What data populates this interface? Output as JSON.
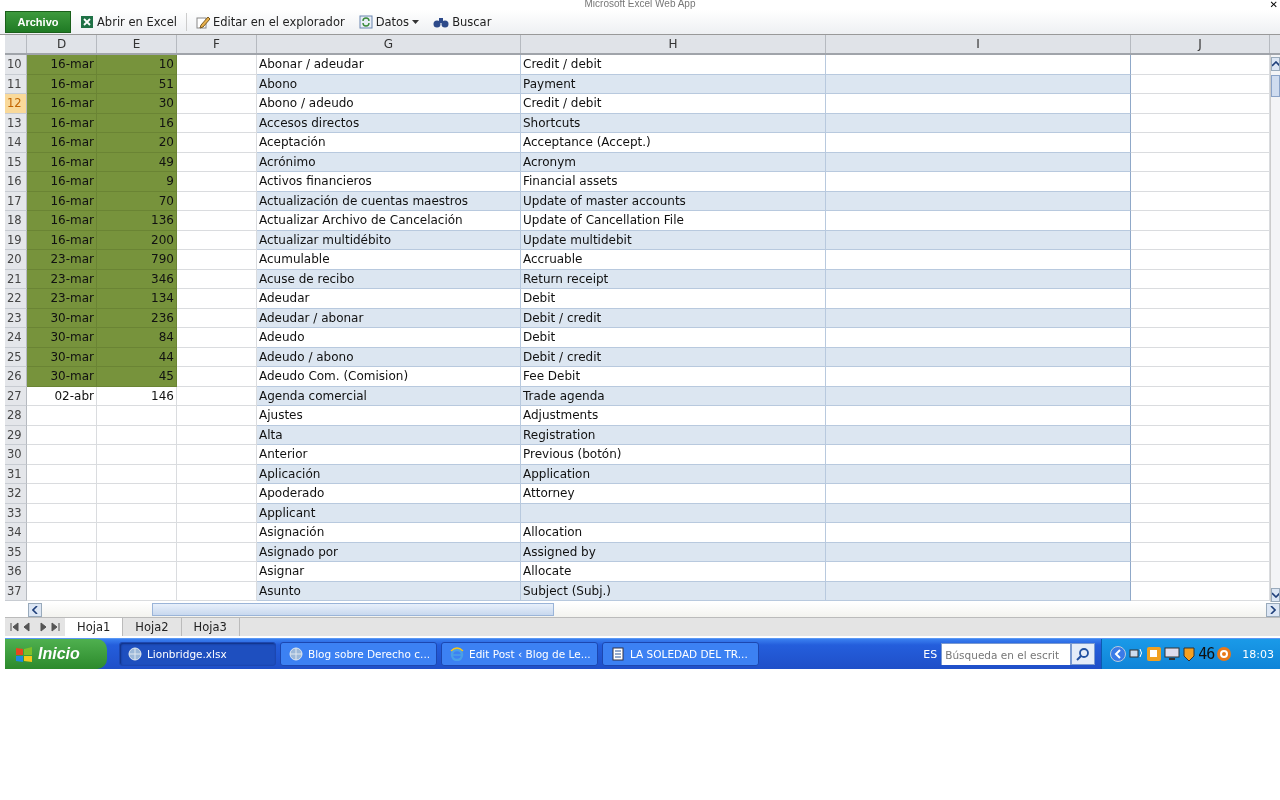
{
  "window": {
    "title": "Microsoft Excel Web App",
    "close": "✕"
  },
  "toolbar": {
    "file_tab": "Archivo",
    "buttons": [
      {
        "label": "Abrir en Excel",
        "kind": "excel"
      },
      {
        "label": "Editar en el explorador",
        "kind": "edit"
      },
      {
        "label": "Datos",
        "kind": "data"
      },
      {
        "label": "Buscar",
        "kind": "find"
      }
    ]
  },
  "columns": [
    "D",
    "E",
    "F",
    "G",
    "H",
    "I",
    "J"
  ],
  "rows": [
    {
      "n": "10",
      "date": "16-mar",
      "value": "10",
      "es": "Abonar / adeudar",
      "en": "Credit / debit",
      "filled": true,
      "selected": false
    },
    {
      "n": "11",
      "date": "16-mar",
      "value": "51",
      "es": "Abono",
      "en": "Payment",
      "filled": true,
      "selected": false
    },
    {
      "n": "12",
      "date": "16-mar",
      "value": "30",
      "es": "Abono / adeudo",
      "en": "Credit / debit",
      "filled": true,
      "selected": true
    },
    {
      "n": "13",
      "date": "16-mar",
      "value": "16",
      "es": "Accesos directos",
      "en": "Shortcuts",
      "filled": true,
      "selected": false
    },
    {
      "n": "14",
      "date": "16-mar",
      "value": "20",
      "es": "Aceptación",
      "en": "Acceptance (Accept.)",
      "filled": true,
      "selected": false
    },
    {
      "n": "15",
      "date": "16-mar",
      "value": "49",
      "es": "Acrónimo",
      "en": "Acronym",
      "filled": true,
      "selected": false
    },
    {
      "n": "16",
      "date": "16-mar",
      "value": "9",
      "es": "Activos financieros",
      "en": "Financial assets",
      "filled": true,
      "selected": false
    },
    {
      "n": "17",
      "date": "16-mar",
      "value": "70",
      "es": "Actualización de cuentas maestros",
      "en": "Update of master accounts",
      "filled": true,
      "selected": false
    },
    {
      "n": "18",
      "date": "16-mar",
      "value": "136",
      "es": "Actualizar Archivo de Cancelación",
      "en": "Update of Cancellation File",
      "filled": true,
      "selected": false
    },
    {
      "n": "19",
      "date": "16-mar",
      "value": "200",
      "es": "Actualizar multidébito",
      "en": "Update multidebit",
      "filled": true,
      "selected": false
    },
    {
      "n": "20",
      "date": "23-mar",
      "value": "790",
      "es": "Acumulable",
      "en": "Accruable",
      "filled": true,
      "selected": false
    },
    {
      "n": "21",
      "date": "23-mar",
      "value": "346",
      "es": "Acuse de recibo",
      "en": "Return receipt",
      "filled": true,
      "selected": false
    },
    {
      "n": "22",
      "date": "23-mar",
      "value": "134",
      "es": "Adeudar",
      "en": "Debit",
      "filled": true,
      "selected": false
    },
    {
      "n": "23",
      "date": "30-mar",
      "value": "236",
      "es": "Adeudar / abonar",
      "en": "Debit / credit",
      "filled": true,
      "selected": false
    },
    {
      "n": "24",
      "date": "30-mar",
      "value": "84",
      "es": "Adeudo",
      "en": "Debit",
      "filled": true,
      "selected": false
    },
    {
      "n": "25",
      "date": "30-mar",
      "value": "44",
      "es": "Adeudo / abono",
      "en": "Debit / credit",
      "filled": true,
      "selected": false
    },
    {
      "n": "26",
      "date": "30-mar",
      "value": "45",
      "es": "Adeudo Com. (Comision)",
      "en": "Fee Debit",
      "filled": true,
      "selected": false
    },
    {
      "n": "27",
      "date": "02-abr",
      "value": "146",
      "es": "Agenda comercial",
      "en": "Trade agenda",
      "filled": false,
      "selected": false
    },
    {
      "n": "28",
      "es": "Ajustes",
      "en": "Adjustments",
      "filled": false,
      "selected": false
    },
    {
      "n": "29",
      "es": "Alta",
      "en": "Registration",
      "filled": false,
      "selected": false
    },
    {
      "n": "30",
      "es": "Anterior",
      "en": "Previous (botón)",
      "filled": false,
      "selected": false
    },
    {
      "n": "31",
      "es": "Aplicación",
      "en": "Application",
      "filled": false,
      "selected": false
    },
    {
      "n": "32",
      "es": "Apoderado",
      "en": "Attorney",
      "filled": false,
      "selected": false
    },
    {
      "n": "33",
      "es": "Applicant",
      "filled": false,
      "selected": false
    },
    {
      "n": "34",
      "es": "Asignación",
      "en": "Allocation",
      "filled": false,
      "selected": false
    },
    {
      "n": "35",
      "es": "Asignado por",
      "en": "Assigned by",
      "filled": false,
      "selected": false
    },
    {
      "n": "36",
      "es": "Asignar",
      "en": "Allocate",
      "filled": false,
      "selected": false
    },
    {
      "n": "37",
      "es": "Asunto",
      "en": "Subject (Subj.)",
      "filled": false,
      "selected": false
    }
  ],
  "sheet_tabs": [
    {
      "label": "Hoja1",
      "selected": true
    },
    {
      "label": "Hoja2",
      "selected": false
    },
    {
      "label": "Hoja3",
      "selected": false
    }
  ],
  "taskbar": {
    "start": "Inicio",
    "tasks": [
      {
        "label": "Lionbridge.xlsx",
        "kind": "globe",
        "selected": true
      },
      {
        "label": "Blog sobre Derecho c...",
        "kind": "globe",
        "selected": false
      },
      {
        "label": "Edit Post ‹ Blog de Le...",
        "kind": "ie",
        "selected": false
      },
      {
        "label": "LA SOLEDAD DEL TR...",
        "kind": "doc",
        "selected": false
      }
    ],
    "language": "ES",
    "search": {
      "placeholder": "Búsqueda en el escrit"
    },
    "tray_text": "46",
    "clock": "18:03"
  }
}
